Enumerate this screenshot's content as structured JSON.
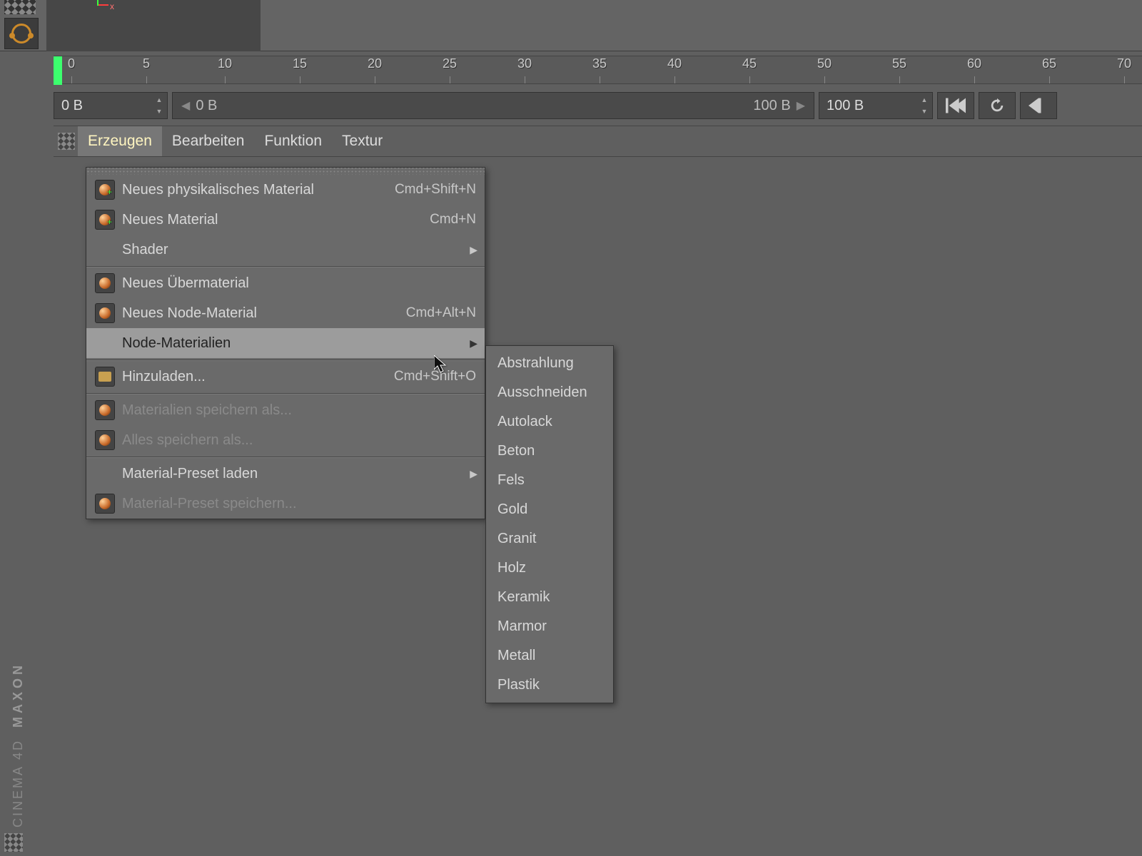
{
  "axis": {
    "x_label": "x"
  },
  "timeline_ticks": [
    "0",
    "5",
    "10",
    "15",
    "20",
    "25",
    "30",
    "35",
    "40",
    "45",
    "50",
    "55",
    "60",
    "65",
    "70"
  ],
  "frame_controls": {
    "current": "0 B",
    "range_start": "0 B",
    "range_end": "100 B",
    "total": "100 B"
  },
  "menubar": {
    "items": [
      "Erzeugen",
      "Bearbeiten",
      "Funktion",
      "Textur"
    ],
    "active_index": 0
  },
  "dropdown": {
    "groups": [
      [
        {
          "icon": "material-add",
          "label": "Neues physikalisches Material",
          "shortcut": "Cmd+Shift+N"
        },
        {
          "icon": "material-add",
          "label": "Neues Material",
          "shortcut": "Cmd+N"
        },
        {
          "icon": "blank",
          "label": "Shader",
          "submenu": true
        }
      ],
      [
        {
          "icon": "material",
          "label": "Neues Übermaterial"
        },
        {
          "icon": "material",
          "label": "Neues Node-Material",
          "shortcut": "Cmd+Alt+N"
        },
        {
          "icon": "blank",
          "label": "Node-Materialien",
          "submenu": true,
          "hover": true
        }
      ],
      [
        {
          "icon": "folder",
          "label": "Hinzuladen...",
          "shortcut": "Cmd+Shift+O"
        }
      ],
      [
        {
          "icon": "material",
          "label": "Materialien speichern als...",
          "disabled": true
        },
        {
          "icon": "material",
          "label": "Alles speichern als...",
          "disabled": true
        }
      ],
      [
        {
          "icon": "blank",
          "label": "Material-Preset laden",
          "submenu": true
        },
        {
          "icon": "material",
          "label": "Material-Preset speichern...",
          "disabled": true
        }
      ]
    ]
  },
  "submenu_items": [
    "Abstrahlung",
    "Ausschneiden",
    "Autolack",
    "Beton",
    "Fels",
    "Gold",
    "Granit",
    "Holz",
    "Keramik",
    "Marmor",
    "Metall",
    "Plastik"
  ],
  "brand": {
    "vendor": "MAXON",
    "product": "CINEMA 4D"
  }
}
